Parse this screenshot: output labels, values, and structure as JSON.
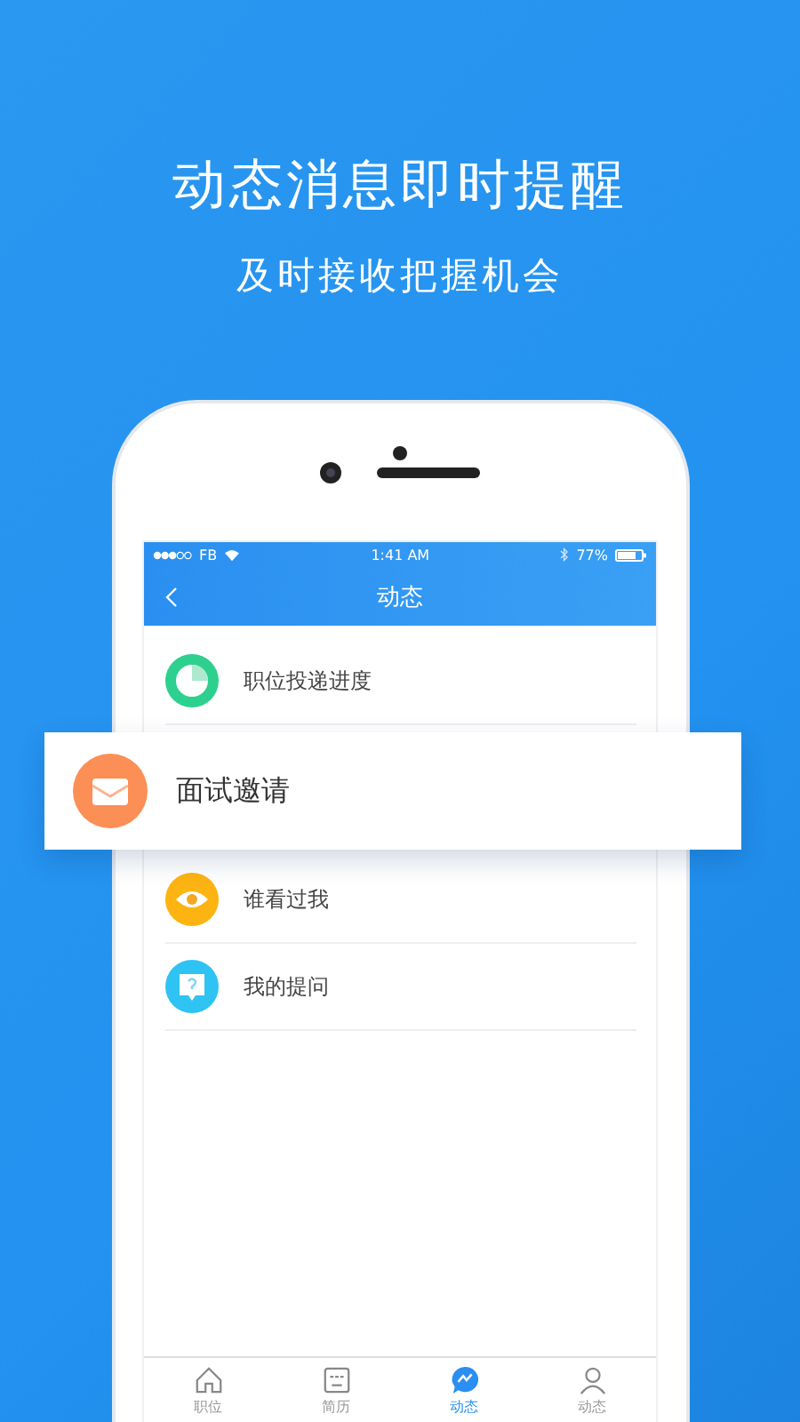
{
  "headline": "动态消息即时提醒",
  "subtitle": "及时接收把握机会",
  "status_bar": {
    "carrier": "FB",
    "time": "1:41 AM",
    "battery": "77%"
  },
  "nav": {
    "title": "动态"
  },
  "items": [
    {
      "label": "职位投递进度",
      "kind": "row"
    },
    {
      "label": "面试邀请",
      "kind": "popout"
    },
    {
      "label": "谁看过我",
      "kind": "row"
    },
    {
      "label": "我的提问",
      "kind": "row"
    }
  ],
  "tabs": [
    {
      "label": "职位",
      "selected": false
    },
    {
      "label": "简历",
      "selected": false
    },
    {
      "label": "动态",
      "selected": true
    },
    {
      "label": "动态",
      "selected": false
    }
  ]
}
